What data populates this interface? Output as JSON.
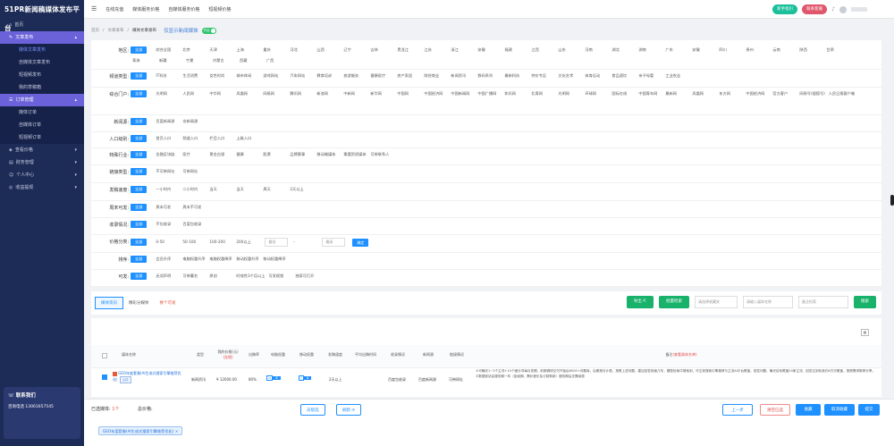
{
  "app": {
    "brand": "51PR新闻稿媒体发布平台"
  },
  "topbar": {
    "links": [
      "在线充值",
      "媒体服务价格",
      "自媒体服务价格",
      "短视频价格"
    ],
    "guide_btn": "新手指引",
    "contact_btn": "联系客服",
    "username": "      "
  },
  "sidebar": {
    "home": "首页",
    "article_group": "文章发布",
    "article_items": [
      "媒体文章发布",
      "自媒体文章发布",
      "短视频发布",
      "我的草稿箱"
    ],
    "order_group": "订单管理",
    "order_items": [
      "媒体订单",
      "自媒体订单",
      "短视频订单"
    ],
    "other": [
      "查看价格",
      "财务管理",
      "个人中心",
      "收益提现"
    ],
    "contact_title": "联系我们",
    "contact_lines": [
      "咨询电话 13061657545",
      " ",
      " "
    ]
  },
  "breadcrumb": {
    "items": [
      "首页",
      "文章发布",
      "媒体文章发布"
    ],
    "only_label": "仅显示新闻媒体",
    "toggle_text": "开启"
  },
  "filters": [
    {
      "label": "地区:",
      "options": [
        "全部",
        "综合全国",
        "北京",
        "天津",
        "上海",
        "重庆",
        "河北",
        "山西",
        "辽宁",
        "吉林",
        "黑龙江",
        "江苏",
        "浙江",
        "安徽",
        "福建",
        "江西",
        "山东",
        "河南",
        "湖北",
        "湖南",
        "广东",
        "安徽",
        "四川",
        "贵州",
        "云南",
        "陕西",
        "甘肃",
        "青海",
        "新疆",
        "宁夏",
        "内蒙古",
        "西藏",
        "广西"
      ]
    },
    {
      "label": "频道类型:",
      "options": [
        "全部",
        "IT科技",
        "生活消费",
        "女性时尚",
        "城市休闲",
        "游戏网站",
        "汽车网站",
        "教育培训",
        "旅游服务",
        "健康医疗",
        "房产家居",
        "财经商业",
        "新闻资讯",
        "数码系列",
        "最新科技",
        "特价专区",
        "文化艺术",
        "体育运动",
        "食品酒饮",
        "亲子母婴",
        "工业农业"
      ]
    },
    {
      "label": "综合门户:",
      "options": [
        "全部",
        "光明网",
        "人民网",
        "中华网",
        "凤凰网",
        "网易网",
        "腾讯网",
        "新浪网",
        "中新网",
        "新华网",
        "中国网",
        "中国经济网",
        "中国新闻网",
        "中国广播网",
        "和讯网",
        "北青网",
        "光明网",
        "环球网",
        "国际在线",
        "中国青年网",
        "最新网",
        "凤凰网",
        "东方网",
        "中国经济网",
        "官方客户",
        "网易号(搜狐号)",
        "人民日报客户端"
      ]
    },
    {
      "label": "新闻源:",
      "options": [
        "全部",
        "百度新闻源",
        "非新闻源"
      ]
    },
    {
      "label": "入口级别:",
      "options": [
        "全部",
        "首页入口",
        "频道入口",
        "栏目入口",
        "上级入口"
      ]
    },
    {
      "label": "特殊行业:",
      "options": [
        "全部",
        "金融区块链",
        "医疗",
        "黄金白银",
        "健康",
        "股票",
        "品牌赛事",
        "移动端媒体",
        "需要资质媒体",
        "可带联系人"
      ]
    },
    {
      "label": "链接类型:",
      "options": [
        "全部",
        "不可带网址",
        "可带网址"
      ]
    },
    {
      "label": "发稿速度:",
      "options": [
        "全部",
        "一小时内",
        "二小时内",
        "当天",
        "当天",
        "周天",
        "2天以上"
      ]
    },
    {
      "label": "周末可发:",
      "options": [
        "全部",
        "周末可发",
        "周末不可发"
      ]
    },
    {
      "label": "收录情况:",
      "options": [
        "全部",
        "不包收录",
        "百度包收录"
      ]
    },
    {
      "label": "价格分类:",
      "options": [
        "全部",
        "0-50",
        "50-100",
        "100-200",
        "200以上"
      ]
    },
    {
      "label": "排序:",
      "options": [
        "全部",
        "会员升序",
        "电脑权重升序",
        "电脑权重降序",
        "移动权重升序",
        "移动权重降序"
      ]
    },
    {
      "label": "可发:",
      "options": [
        "全部",
        "无须声明",
        "可带署名",
        "原创",
        "时效性3个月以上",
        "可发视频",
        "独家可打开"
      ]
    }
  ],
  "price_filter": {
    "min_placeholder": "最低",
    "max_placeholder": "最高",
    "dash": "-",
    "ok": "确定"
  },
  "tabs": [
    "媒体资讯",
    "精彩分媒体",
    "换个可发"
  ],
  "toolbar": {
    "export": "导出",
    "bulk_search": "批量检索",
    "select_placeholder": "请选择收藏夹",
    "name_placeholder": "请输入媒体名称",
    "note_placeholder": "备注检索",
    "search": "搜索"
  },
  "table": {
    "columns": [
      "媒体名称",
      "类型",
      "我的价格(元)",
      "出稿率",
      "电脑权重",
      "移动权重",
      "发稿速度",
      "平均出稿时间",
      "收录情况",
      "新闻源",
      "链接情况",
      "备注"
    ],
    "col_subnote": "(含税)",
    "note_header_tag": "(查看具体名单)",
    "rows": [
      {
        "name": "GEO年度套餐(AI生成式搜索引擎推荐优化)",
        "tag": "入口",
        "type": "新闻资讯",
        "price": "¥ 12000.00",
        "rate": "80%",
        "pc_weight": "8",
        "mobile_weight": "8",
        "speed": "2天以上",
        "avg_time": "",
        "index": "百度包收录",
        "news_source": "百度新闻源",
        "link": "可带网址",
        "note": "①可曝光1~3个主词+10个细分词每月发稿，前期调研交付开始后6000+问题库，后期按月计费。按照上述问题，建议回答前面几句，模型检索中搜索到，可达到搜索引擎推荐与主流AI平台覆盖，回答问题，曝光目标覆盖20家主流，回答达到标准约6万次覆盖，按照需求推荐分享。②数据到站后服务期一年（如续期，需补差价及订制条款）服务期后无需续费"
      }
    ]
  },
  "footer": {
    "selected_label": "已选媒体:",
    "selected_count": "1个",
    "total_label": "总价格:",
    "total_value": "",
    "copy_btn": "去帮选",
    "refresh_btn": "刷新",
    "prev_btn": "上一步",
    "clear_btn": "清空已选",
    "fav_btn": "收藏",
    "unfav_btn": "取消收藏",
    "submit_btn": "提交",
    "chip": "GEO年度套餐(AI生成式搜索引擎推荐优化)",
    "chip_close": "×"
  }
}
